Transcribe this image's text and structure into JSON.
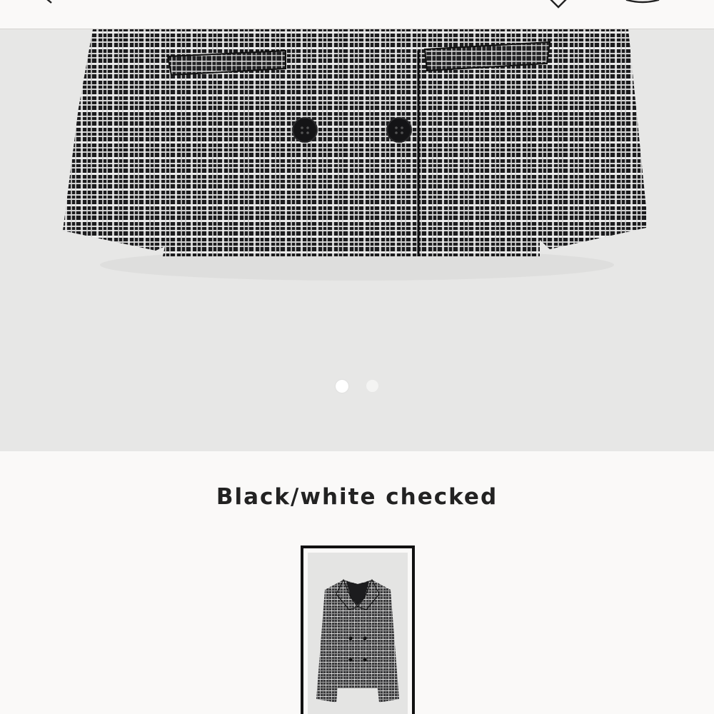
{
  "header": {
    "back_icon": "chevron-left-icon",
    "favorite_icon": "heart-icon",
    "bag_icon": "shopping-bag-icon"
  },
  "gallery": {
    "image_count": 2,
    "active_index": 0,
    "background": "#e7e7e6",
    "fabric_dark": "#1c1c1e",
    "fabric_light": "#f2f2f2"
  },
  "color_section": {
    "selected_color_name": "Black/white checked",
    "swatches": [
      {
        "label": "Black/white checked",
        "selected": true
      }
    ]
  }
}
